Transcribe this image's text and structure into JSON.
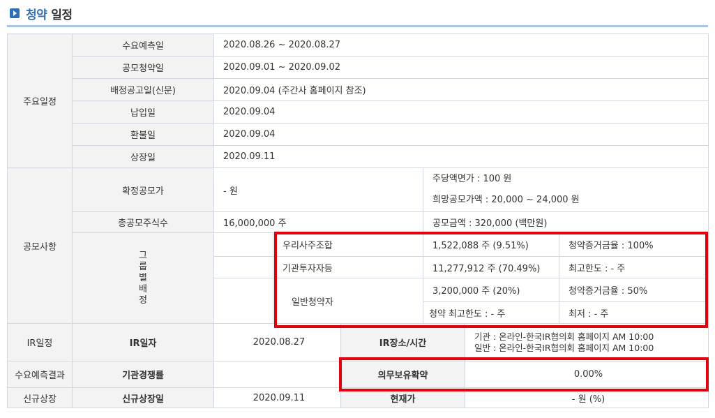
{
  "header": {
    "title_accent": "청약",
    "title_rest": "일정"
  },
  "schedule": {
    "section_label": "주요일정",
    "rows": [
      {
        "label": "수요예측일",
        "value": "2020.08.26  ~   2020.08.27"
      },
      {
        "label": "공모청약일",
        "value": "2020.09.01  ~   2020.09.02"
      },
      {
        "label": "배정공고일(신문)",
        "value": "2020.09.04 (주간사 홈페이지 참조)"
      },
      {
        "label": "납입일",
        "value": "2020.09.04"
      },
      {
        "label": "환불일",
        "value": "2020.09.04"
      },
      {
        "label": "상장일",
        "value": "2020.09.11"
      }
    ]
  },
  "offering": {
    "section_label": "공모사항",
    "confirmed_price_label": "확정공모가",
    "confirmed_price_value": "- 원",
    "par_value": "주당액면가 :  100 원",
    "desired_price": "희망공모가액 :  20,000 ~ 24,000 원",
    "total_shares_label": "총공모주식수",
    "total_shares_value": "16,000,000 주",
    "total_amount": "공모금액 : 320,000 (백만원)",
    "group_label": "그룹별배정",
    "group_rows": [
      {
        "name": "우리사주조합",
        "shares": "1,522,088 주  (9.51%)",
        "note": "청약증거금율 : 100%"
      },
      {
        "name": "기관투자자등",
        "shares": "11,277,912 주  (70.49%)",
        "note": "최고한도 :  - 주"
      },
      {
        "name": "일반청약자",
        "shares": "3,200,000 주  (20%)",
        "note": "청약증거금율 : 50%"
      }
    ],
    "retail_max": "청약 최고한도 :  - 주",
    "retail_min": "최저 :  - 주"
  },
  "ir": {
    "section_label": "IR일정",
    "date_label": "IR일자",
    "date_value": "2020.08.27",
    "place_label": "IR장소/시간",
    "place_line1": "기관 : 온라인-한국IR협의회 홈페이지 AM 10:00",
    "place_line2": "일반 : 온라인-한국IR협의회 홈페이지 AM 10:00"
  },
  "demand": {
    "section_label": "수요예측결과",
    "competition_label": "기관경쟁률",
    "competition_value": "",
    "lockup_label": "의무보유확약",
    "lockup_value": "0.00%"
  },
  "listing": {
    "section_label": "신규상장",
    "date_label": "신규상장일",
    "date_value": "2020.09.11",
    "price_label": "현재가",
    "price_value": "- 원 (%)"
  },
  "highlight_color": "#e3000f"
}
